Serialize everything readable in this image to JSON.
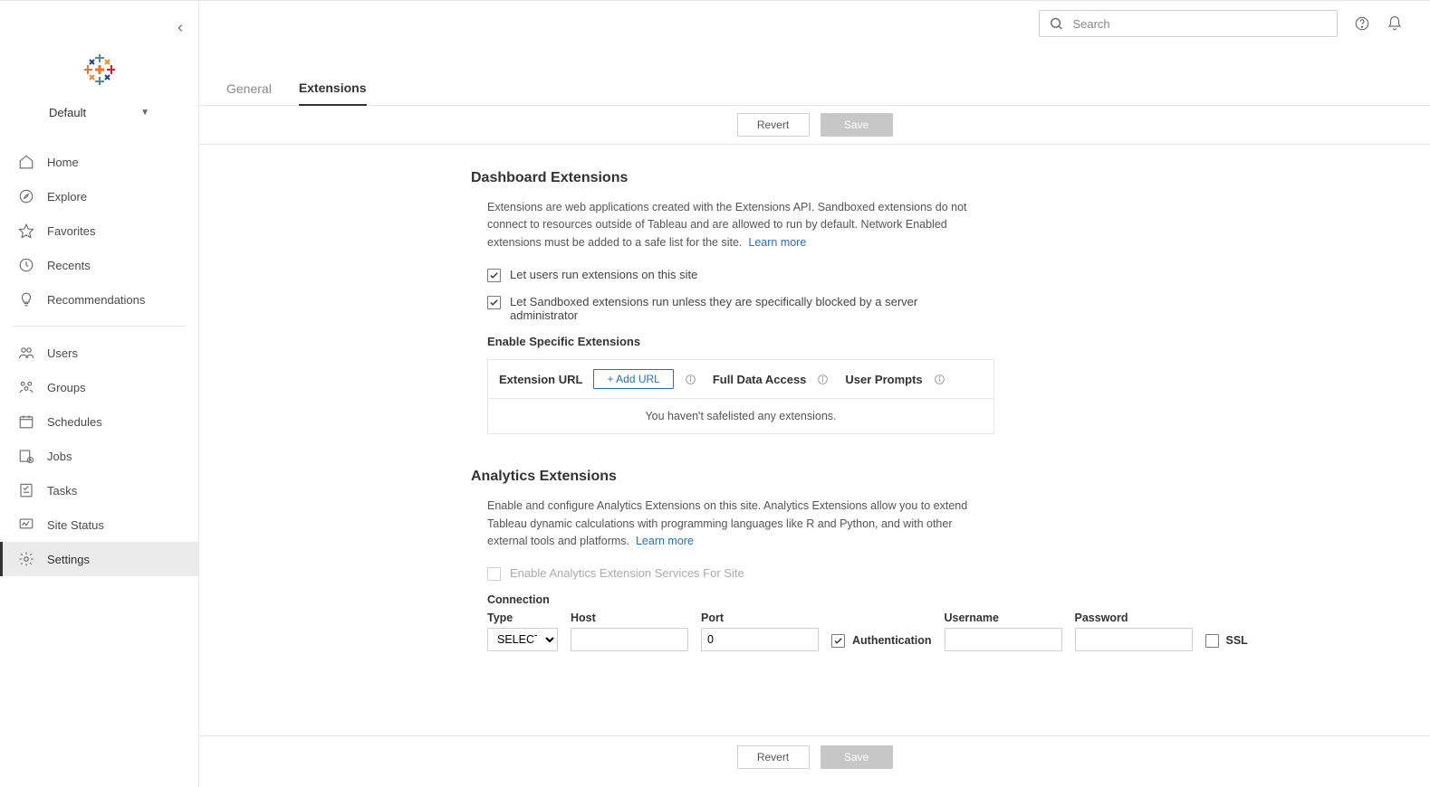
{
  "site": {
    "name": "Default"
  },
  "search": {
    "placeholder": "Search"
  },
  "sidebar": {
    "group1": [
      {
        "id": "home",
        "label": "Home"
      },
      {
        "id": "explore",
        "label": "Explore"
      },
      {
        "id": "favorites",
        "label": "Favorites"
      },
      {
        "id": "recents",
        "label": "Recents"
      },
      {
        "id": "recommendations",
        "label": "Recommendations"
      }
    ],
    "group2": [
      {
        "id": "users",
        "label": "Users"
      },
      {
        "id": "groups",
        "label": "Groups"
      },
      {
        "id": "schedules",
        "label": "Schedules"
      },
      {
        "id": "jobs",
        "label": "Jobs"
      },
      {
        "id": "tasks",
        "label": "Tasks"
      },
      {
        "id": "site-status",
        "label": "Site Status"
      },
      {
        "id": "settings",
        "label": "Settings"
      }
    ]
  },
  "tabs": [
    {
      "id": "general",
      "label": "General",
      "active": false
    },
    {
      "id": "extensions",
      "label": "Extensions",
      "active": true
    }
  ],
  "buttons": {
    "revert": "Revert",
    "save": "Save"
  },
  "dashboard_ext": {
    "title": "Dashboard Extensions",
    "desc": "Extensions are web applications created with the Extensions API. Sandboxed extensions do not connect to resources outside of Tableau and are allowed to run by default. Network Enabled extensions must be added to a safe list for the site.",
    "learn_more": "Learn more",
    "cb1": {
      "checked": true,
      "label": "Let users run extensions on this site"
    },
    "cb2": {
      "checked": true,
      "label": "Let Sandboxed extensions run unless they are specifically blocked by a server administrator"
    },
    "enable_specific": "Enable Specific Extensions",
    "table": {
      "col_url": "Extension URL",
      "add_url": "+ Add URL",
      "col_access": "Full Data Access",
      "col_prompts": "User Prompts",
      "empty": "You haven't safelisted any extensions."
    }
  },
  "analytics_ext": {
    "title": "Analytics Extensions",
    "desc": "Enable and configure Analytics Extensions on this site. Analytics Extensions allow you to extend Tableau dynamic calculations with programming languages like R and Python, and with other external tools and platforms.",
    "learn_more": "Learn more",
    "cb_enable": {
      "checked": false,
      "label": "Enable Analytics Extension Services For Site"
    },
    "connection_label": "Connection",
    "fields": {
      "type": {
        "label": "Type",
        "value": "SELECT"
      },
      "host": {
        "label": "Host",
        "value": ""
      },
      "port": {
        "label": "Port",
        "value": "0"
      },
      "auth": {
        "label": "Authentication",
        "checked": true
      },
      "user": {
        "label": "Username",
        "value": ""
      },
      "pass": {
        "label": "Password",
        "value": ""
      },
      "ssl": {
        "label": "SSL",
        "checked": false
      }
    }
  }
}
